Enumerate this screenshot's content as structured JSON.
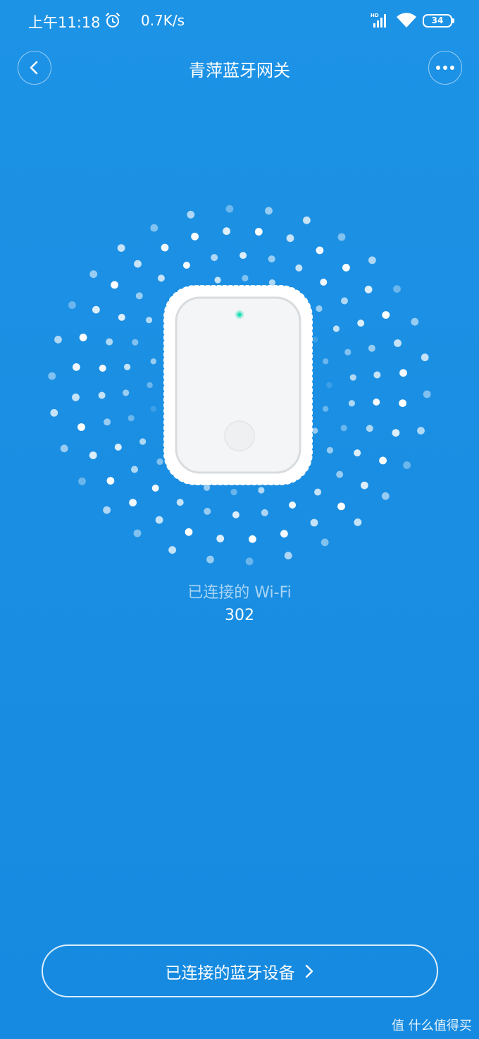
{
  "status_bar": {
    "time": "上午11:18",
    "net_speed": "0.7K/s",
    "network_badge": "HD",
    "battery": "34"
  },
  "header": {
    "title": "青萍蓝牙网关",
    "back_icon": "chevron-left-icon",
    "more_icon": "more-dots-icon"
  },
  "wifi": {
    "label": "已连接的 Wi-Fi",
    "name": "302"
  },
  "bottom_button": {
    "label": "已连接的蓝牙设备"
  },
  "watermark": {
    "text": "值 什么值得买"
  },
  "colors": {
    "background": "#1a8ee2",
    "device_body": "#f4f6f7",
    "led": "#1fe0b5"
  }
}
